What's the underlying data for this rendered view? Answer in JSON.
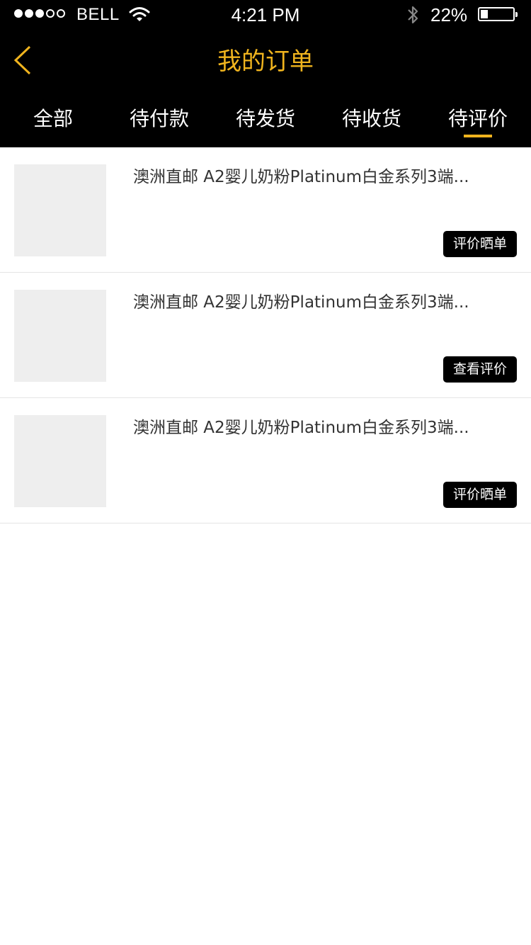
{
  "status_bar": {
    "carrier": "BELL",
    "signal_bars_filled": 3,
    "signal_bars_total": 5,
    "time": "4:21 PM",
    "battery_percent_text": "22%",
    "battery_level": 0.22,
    "icons": [
      "signal-dots-icon",
      "wifi-icon",
      "bluetooth-icon",
      "battery-icon"
    ]
  },
  "nav": {
    "title": "我的订单",
    "back_icon": "chevron-left-icon",
    "accent_color": "#f0b41e"
  },
  "tabs": [
    {
      "label": "全部",
      "active": false
    },
    {
      "label": "待付款",
      "active": false
    },
    {
      "label": "待发货",
      "active": false
    },
    {
      "label": "待收货",
      "active": false
    },
    {
      "label": "待评价",
      "active": true
    }
  ],
  "orders": [
    {
      "name": "澳洲直邮 A2婴儿奶粉Platinum白金系列3端...",
      "action": "评价晒单"
    },
    {
      "name": "澳洲直邮 A2婴儿奶粉Platinum白金系列3端...",
      "action": "查看评价"
    },
    {
      "name": "澳洲直邮 A2婴儿奶粉Platinum白金系列3端...",
      "action": "评价晒单"
    }
  ]
}
